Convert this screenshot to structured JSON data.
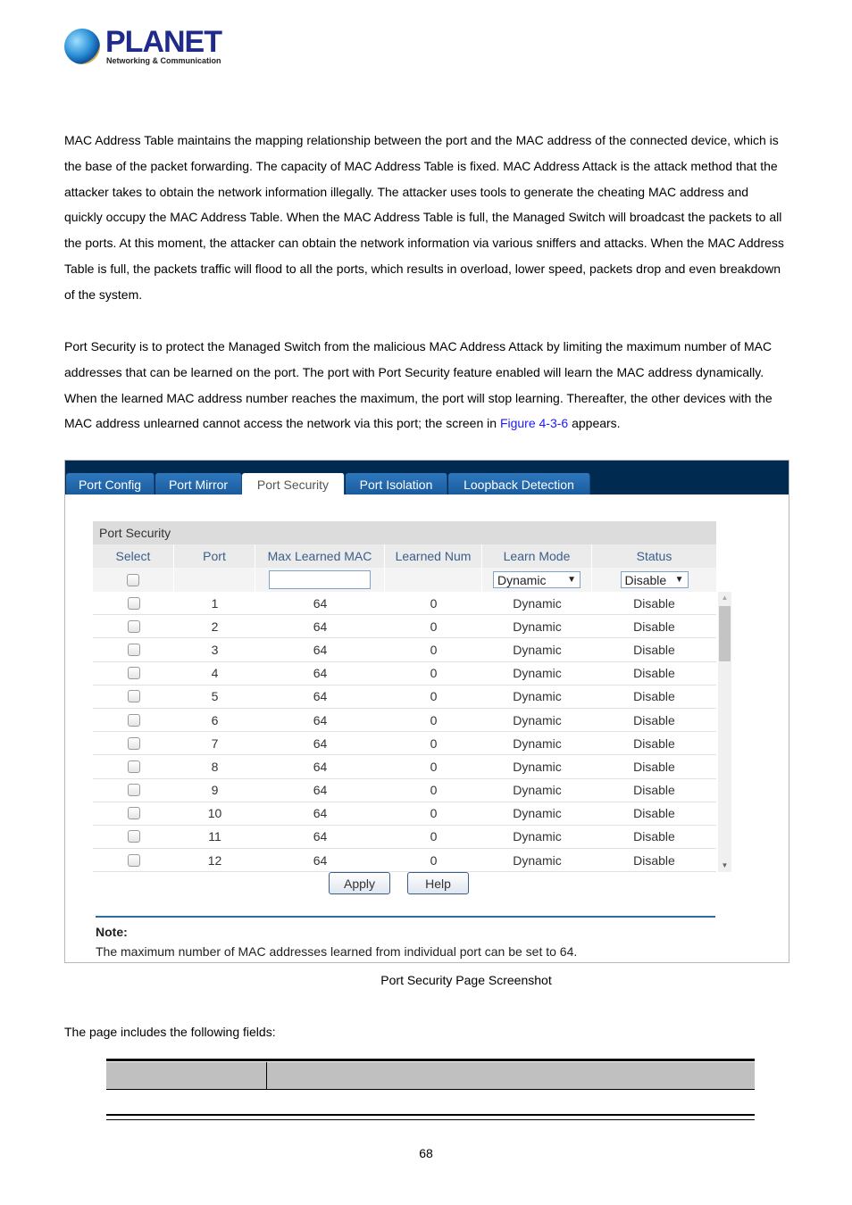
{
  "logo": {
    "brand": "PLANET",
    "tagline": "Networking & Communication"
  },
  "paragraphs": [
    "MAC Address Table maintains the mapping relationship between the port and the MAC address of the connected device, which is the base of the packet forwarding. The capacity of MAC Address Table is fixed. MAC Address Attack is the attack method that the attacker takes to obtain the network information illegally. The attacker uses tools to generate the cheating MAC address and quickly occupy the MAC Address Table. When the MAC Address Table is full, the Managed Switch will broadcast the packets to all the ports. At this moment, the attacker can obtain the network information via various sniffers and attacks. When the MAC Address Table is full, the packets traffic will flood to all the ports, which results in overload, lower speed, packets drop and even breakdown of the system.",
    "Port Security is to protect the Managed Switch from the malicious MAC Address Attack by limiting the maximum number of MAC addresses that can be learned on the port. The port with Port Security feature enabled will learn the MAC address dynamically. When the learned MAC address number reaches the maximum, the port will stop learning. Thereafter, the other devices with the MAC address unlearned cannot access the network via this port; the screen in"
  ],
  "figure_link": "Figure 4-3-6",
  "para2_end": " appears.",
  "ui": {
    "tabs": [
      {
        "label": "Port Config",
        "active": false
      },
      {
        "label": "Port Mirror",
        "active": false
      },
      {
        "label": "Port Security",
        "active": true
      },
      {
        "label": "Port Isolation",
        "active": false
      },
      {
        "label": "Loopback Detection",
        "active": false
      }
    ],
    "table_title": "Port Security",
    "columns": [
      "Select",
      "Port",
      "Max Learned MAC",
      "Learned Num",
      "Learn Mode",
      "Status"
    ],
    "filter": {
      "max_learned_value": "",
      "learn_mode": "Dynamic",
      "status": "Disable"
    },
    "rows": [
      {
        "port": "1",
        "max": "64",
        "learned": "0",
        "mode": "Dynamic",
        "status": "Disable"
      },
      {
        "port": "2",
        "max": "64",
        "learned": "0",
        "mode": "Dynamic",
        "status": "Disable"
      },
      {
        "port": "3",
        "max": "64",
        "learned": "0",
        "mode": "Dynamic",
        "status": "Disable"
      },
      {
        "port": "4",
        "max": "64",
        "learned": "0",
        "mode": "Dynamic",
        "status": "Disable"
      },
      {
        "port": "5",
        "max": "64",
        "learned": "0",
        "mode": "Dynamic",
        "status": "Disable"
      },
      {
        "port": "6",
        "max": "64",
        "learned": "0",
        "mode": "Dynamic",
        "status": "Disable"
      },
      {
        "port": "7",
        "max": "64",
        "learned": "0",
        "mode": "Dynamic",
        "status": "Disable"
      },
      {
        "port": "8",
        "max": "64",
        "learned": "0",
        "mode": "Dynamic",
        "status": "Disable"
      },
      {
        "port": "9",
        "max": "64",
        "learned": "0",
        "mode": "Dynamic",
        "status": "Disable"
      },
      {
        "port": "10",
        "max": "64",
        "learned": "0",
        "mode": "Dynamic",
        "status": "Disable"
      },
      {
        "port": "11",
        "max": "64",
        "learned": "0",
        "mode": "Dynamic",
        "status": "Disable"
      },
      {
        "port": "12",
        "max": "64",
        "learned": "0",
        "mode": "Dynamic",
        "status": "Disable"
      }
    ],
    "apply_label": "Apply",
    "help_label": "Help",
    "note_title": "Note:",
    "note_text": "The maximum number of MAC addresses learned from individual port can be set to 64."
  },
  "caption": "Port Security Page Screenshot",
  "fields_intro": "The page includes the following fields:",
  "page_number": "68"
}
